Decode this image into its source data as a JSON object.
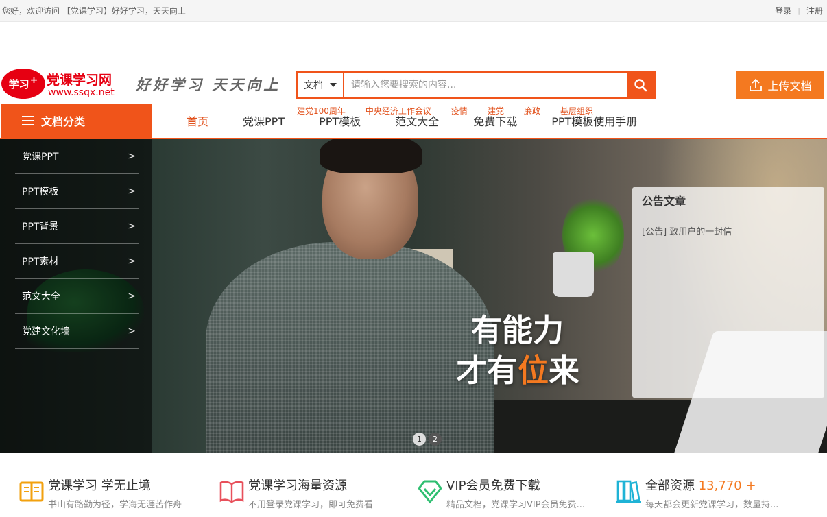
{
  "topbar": {
    "welcome": "您好，欢迎访问 【党课学习】好好学习，天天向上",
    "login": "登录",
    "separator": "|",
    "register": "注册"
  },
  "logo": {
    "badge": "学习",
    "badge_plus": "+",
    "title": "党课学习网",
    "url": "www.ssqx.net"
  },
  "slogan": "好好学习 天天向上",
  "search": {
    "type_label": "文档",
    "placeholder": "请输入您要搜索的内容...",
    "hotwords": [
      "建党100周年",
      "中央经济工作会议",
      "疫情",
      "建党",
      "廉政",
      "基层组织"
    ]
  },
  "upload": {
    "label": "上传文档"
  },
  "nav": {
    "category_label": "文档分类",
    "links": [
      "首页",
      "党课PPT",
      "PPT模板",
      "范文大全",
      "免费下载",
      "PPT模板使用手册"
    ]
  },
  "side_menu": [
    "党课PPT",
    "PPT模板",
    "PPT背景",
    "PPT素材",
    "范文大全",
    "党建文化墙"
  ],
  "banner": {
    "line1": "有能力",
    "line2_pre": "才有",
    "line2_hl": "位",
    "line2_post": "来",
    "dots": [
      "1",
      "2"
    ]
  },
  "notice": {
    "title": "公告文章",
    "items": [
      "[公告] 致用户的一封信"
    ]
  },
  "features": [
    {
      "icon": "book-icon",
      "title": "党课学习 学无止境",
      "desc": "书山有路勤为径，学海无涯苦作舟"
    },
    {
      "icon": "open-book-icon",
      "title": "党课学习海量资源",
      "desc": "不用登录党课学习，即可免费看"
    },
    {
      "icon": "diamond-icon",
      "title": "VIP会员免费下载",
      "desc": "精品文档，党课学习VIP会员免费..."
    },
    {
      "icon": "library-icon",
      "title_pre": "全部资源",
      "title_num": "13,770 +",
      "desc": "每天都会更新党课学习，数量持..."
    }
  ],
  "colors": {
    "accent": "#f0541a",
    "upload": "#f47920",
    "brand_red": "#e60012",
    "hotword": "#e2521d"
  }
}
